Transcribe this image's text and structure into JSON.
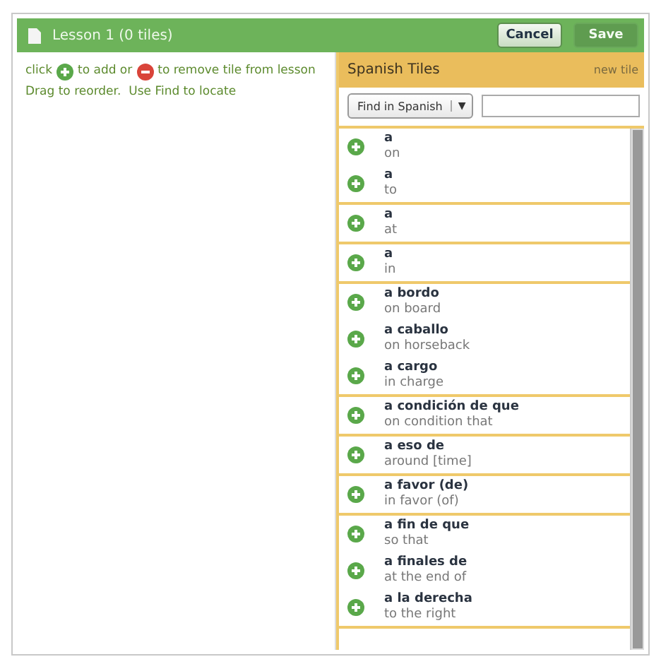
{
  "window": {
    "title": "Lesson 1 (0 tiles)"
  },
  "buttons": [
    {
      "label": "Cancel",
      "disabled": false
    },
    {
      "label": "Save",
      "disabled": true
    }
  ],
  "instructions": {
    "line_1": [
      "click",
      "to add or",
      "to remove tile from lesson"
    ],
    "line_2": "Drag to reorder.  Use Find to locate"
  },
  "tiles_panel": {
    "title": "Spanish Tiles",
    "link": "new tile",
    "search_mode": "Find in Spanish",
    "dropdown_caret": "▼"
  },
  "tile_groups": [
    [
      {
        "term": "a",
        "meaning": "on"
      },
      {
        "term": "a",
        "meaning": "to"
      }
    ],
    [
      {
        "term": "a",
        "meaning": "at"
      }
    ],
    [
      {
        "term": "a",
        "meaning": "in"
      }
    ],
    [
      {
        "term": "a bordo",
        "meaning": "on board"
      },
      {
        "term": "a caballo",
        "meaning": "on horseback"
      },
      {
        "term": "a cargo",
        "meaning": "in charge"
      }
    ],
    [
      {
        "term": "a condición de que",
        "meaning": "on condition that"
      }
    ],
    [
      {
        "term": "a eso de",
        "meaning": "around [time]"
      }
    ],
    [
      {
        "term": "a favor (de)",
        "meaning": "in favor (of)"
      }
    ],
    [
      {
        "term": "a fin de que",
        "meaning": "so that"
      },
      {
        "term": "a finales de",
        "meaning": "at the end of"
      },
      {
        "term": "a la derecha",
        "meaning": "to the right"
      }
    ]
  ]
}
